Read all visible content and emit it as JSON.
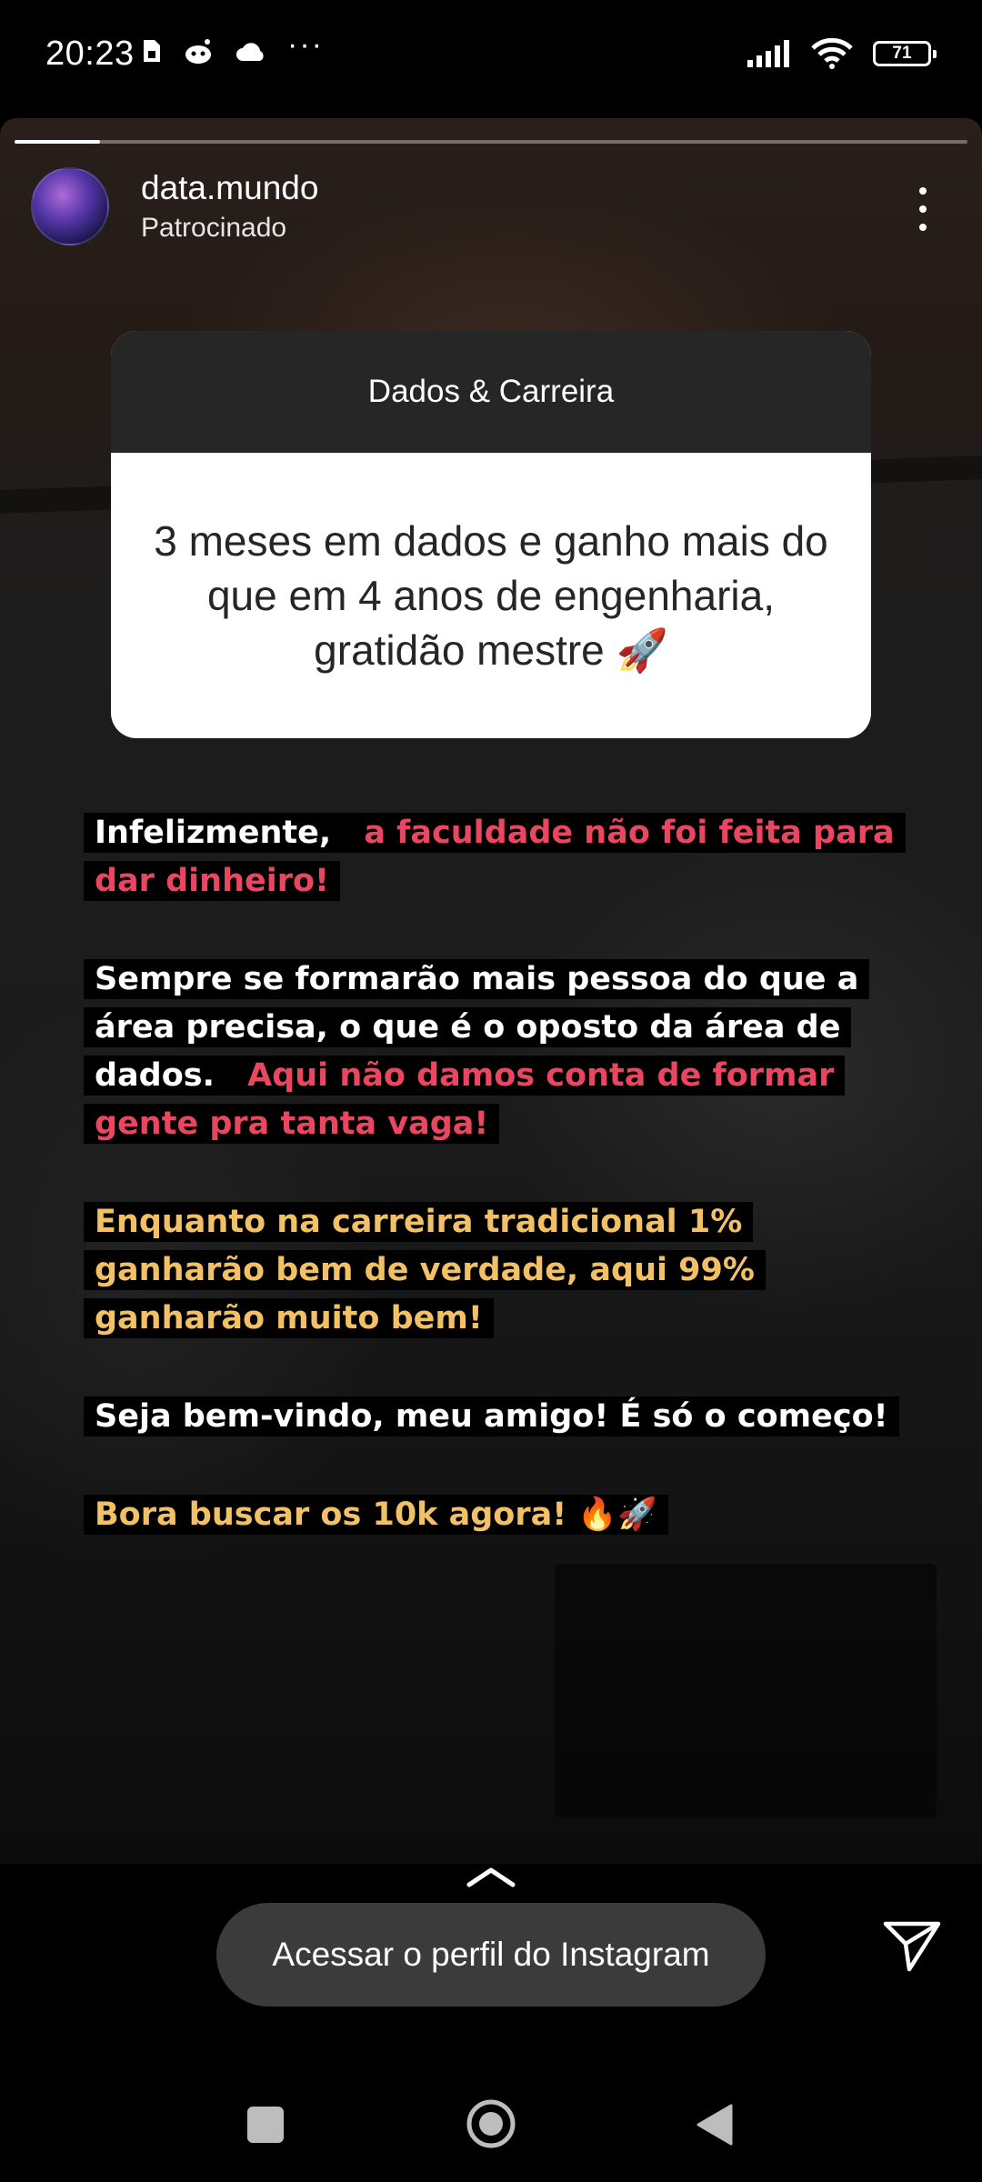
{
  "status_bar": {
    "time": "20:23",
    "battery": "71",
    "more": "···"
  },
  "story": {
    "progress_fraction": 0.09,
    "username": "data.mundo",
    "sponsored_label": "Patrocinado"
  },
  "question_box": {
    "title": "Dados & Carreira",
    "text": "3 meses em dados e ganho mais do que em 4 anos de engenharia, gratidão mestre 🚀"
  },
  "captions": [
    {
      "segments": [
        {
          "text": "Infelizmente, ",
          "color": "#ffffff"
        },
        {
          "text": "a faculdade não foi feita para dar dinheiro!",
          "color": "#ea4660"
        }
      ]
    },
    {
      "segments": [
        {
          "text": "Sempre se formarão mais pessoa do que a área precisa, o que é o oposto da área de dados. ",
          "color": "#ffffff"
        },
        {
          "text": "Aqui não damos conta de formar gente pra tanta vaga!",
          "color": "#ea4660"
        }
      ]
    },
    {
      "segments": [
        {
          "text": "Enquanto na carreira tradicional 1% ganharão bem de verdade, aqui 99% ganharão muito bem!",
          "color": "#f3c165"
        }
      ]
    },
    {
      "segments": [
        {
          "text": "Seja bem-vindo, meu amigo! É só o começo!",
          "color": "#ffffff"
        }
      ]
    },
    {
      "segments": [
        {
          "text": "Bora buscar os 10k agora! 🔥🚀",
          "color": "#f3c165"
        }
      ]
    }
  ],
  "cta": {
    "label": "Acessar o perfil do Instagram"
  },
  "icons": {
    "more": "more-vertical-icon",
    "send": "send-icon",
    "swipe_up": "chevron-up-icon",
    "nav_recents": "recents-square-icon",
    "nav_home": "home-circle-icon",
    "nav_back": "back-triangle-icon"
  }
}
